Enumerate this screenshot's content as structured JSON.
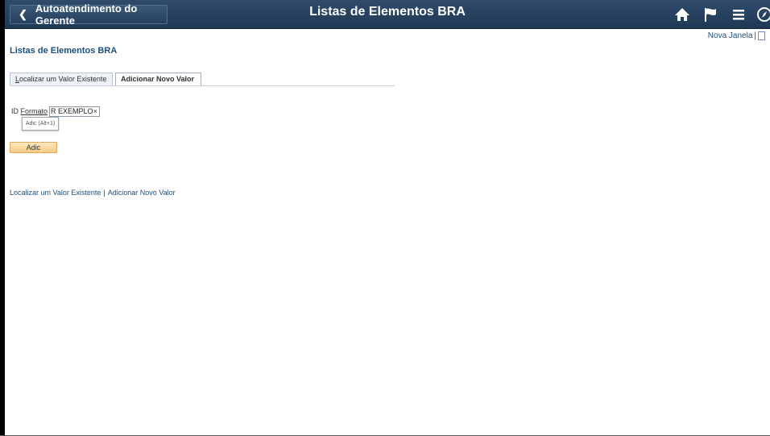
{
  "header": {
    "back_label": "Autoatendimento do Gerente",
    "title": "Listas de Elementos BRA",
    "icons": [
      "home-icon",
      "flag-icon",
      "menu-icon",
      "compass-icon"
    ],
    "bg_color": "#203955"
  },
  "top_links": {
    "new_window": "Nova Janela",
    "separator": "|"
  },
  "page": {
    "title": "Listas de Elementos BRA"
  },
  "tabs": [
    {
      "label_access": "L",
      "label_rest": "ocalizar um Valor Existente",
      "active": false
    },
    {
      "label": "Adicionar Novo Valor",
      "active": true
    }
  ],
  "form": {
    "field_label_pre": "ID ",
    "field_label_link": "Formato",
    "field_value": "R EXEMPLO",
    "clear_symbol": "×",
    "tooltip": "Adic (Alt+1)",
    "add_button": "Adic",
    "add_button_color": "#f7cb86"
  },
  "bottom_links": {
    "find": "Localizar um Valor Existente",
    "separator": "|",
    "add": "Adicionar Novo Valor"
  }
}
